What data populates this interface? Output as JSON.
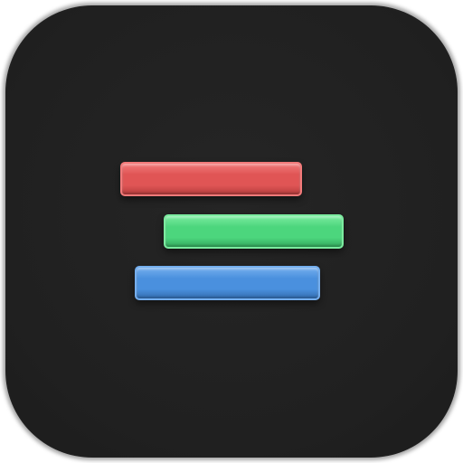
{
  "icon": {
    "name": "app-icon",
    "background": "#212121"
  },
  "bars": [
    {
      "name": "red-bar",
      "color": "#E05555",
      "highlight": "#F27A7A",
      "edge": "#B63E3E"
    },
    {
      "name": "green-bar",
      "color": "#4CD67D",
      "highlight": "#7BEB9F",
      "edge": "#34A95E"
    },
    {
      "name": "blue-bar",
      "color": "#4A90DE",
      "highlight": "#74AEEE",
      "edge": "#336DB0"
    }
  ]
}
